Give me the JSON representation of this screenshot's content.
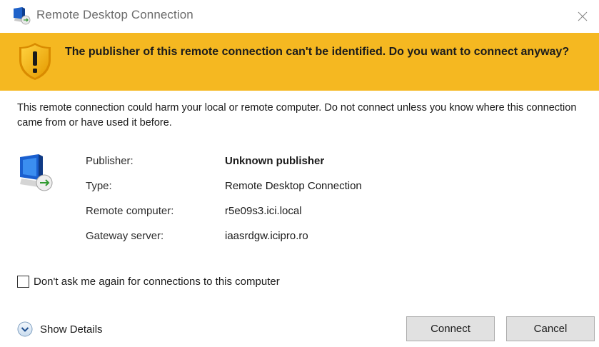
{
  "window": {
    "title": "Remote Desktop Connection",
    "icon": "remote-desktop-icon",
    "close_icon": "close-icon"
  },
  "banner": {
    "text": "The publisher of this remote connection can't be identified. Do you want to connect anyway?",
    "icon": "warning-shield-icon",
    "color": "#f5b821"
  },
  "warning_message": "This remote connection could harm your local or remote computer. Do not connect unless you know where this connection came from or have used it before.",
  "details": {
    "icon": "remote-computer-icon",
    "rows": [
      {
        "label": "Publisher:",
        "value": "Unknown publisher"
      },
      {
        "label": "Type:",
        "value": "Remote Desktop Connection"
      },
      {
        "label": "Remote computer:",
        "value": "r5e09s3.ici.local"
      },
      {
        "label": "Gateway server:",
        "value": "iaasrdgw.icipro.ro"
      }
    ]
  },
  "checkbox": {
    "label": "Don't ask me again for connections to this computer",
    "checked": false
  },
  "show_details": {
    "label": "Show Details",
    "icon": "chevron-down-icon"
  },
  "buttons": {
    "connect": "Connect",
    "cancel": "Cancel"
  }
}
